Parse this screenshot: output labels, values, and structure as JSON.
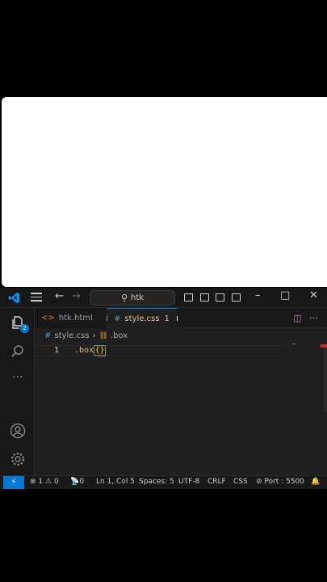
{
  "titlebar": {
    "search_text": "htk",
    "icons": [
      "vscode-logo-icon",
      "menu-icon",
      "back-arrow-icon",
      "forward-arrow-icon",
      "search-icon",
      "toggle-sidebar-icon",
      "toggle-panel-icon",
      "toggle-secondary-sidebar-icon",
      "customize-layout-icon",
      "minimize-icon",
      "maximize-icon",
      "close-icon"
    ]
  },
  "activity": {
    "explorer_badge": "2"
  },
  "tabs": [
    {
      "label": "htk.html",
      "icon": "hash",
      "modified": true
    },
    {
      "label": "style.css",
      "problems": "1",
      "modified": true,
      "active": true
    }
  ],
  "breadcrumb": {
    "file": "style.css",
    "symbol": ".box"
  },
  "editor": {
    "line_number": "1",
    "code_selector": ".box",
    "code_braces": "{}"
  },
  "statusbar": {
    "errors": "1",
    "warnings": "0",
    "ports": "0",
    "position": "Ln 1, Col 5",
    "spaces": "Spaces: 5",
    "encoding": "UTF-8",
    "eol": "CRLF",
    "language": "CSS",
    "port": "Port : 5500"
  },
  "colors": {
    "accent": "#0078d4",
    "css_tab": "#e2c08d",
    "selector": "#d7ba7d",
    "error": "#f14c4c"
  }
}
